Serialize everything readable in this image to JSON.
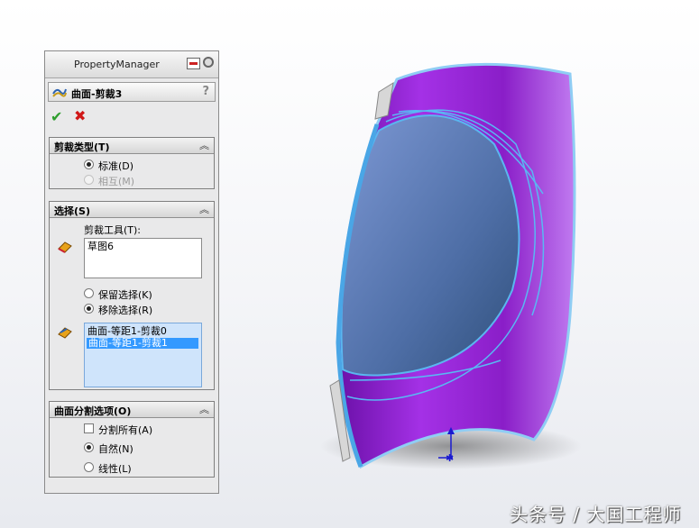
{
  "panel": {
    "title": "PropertyManager",
    "feature_title": "曲面-剪裁3",
    "help": "?"
  },
  "actions": {
    "ok": "✔",
    "cancel": "✖"
  },
  "trim_type": {
    "header": "剪裁类型(T)",
    "standard": "标准(D)",
    "mutual": "相互(M)",
    "selected": "standard"
  },
  "selections": {
    "header": "选择(S)",
    "trim_tool_label": "剪裁工具(T):",
    "trim_tool_items": [
      "草图6"
    ],
    "keep_label": "保留选择(K)",
    "remove_label": "移除选择(R)",
    "selected_mode": "remove",
    "pieces": [
      "曲面-等距1-剪裁0",
      "曲面-等距1-剪裁1"
    ],
    "selected_piece_index": 1
  },
  "surface_split": {
    "header": "曲面分割选项(O)",
    "split_all": "分割所有(A)",
    "natural": "自然(N)",
    "linear": "线性(L)",
    "selected": "natural",
    "split_all_checked": false
  },
  "watermark": "头条号 / 大国工程师",
  "colors": {
    "accent": "#3399ff",
    "model_purple": "#8a1ec8",
    "model_edge": "#49b6f2"
  }
}
